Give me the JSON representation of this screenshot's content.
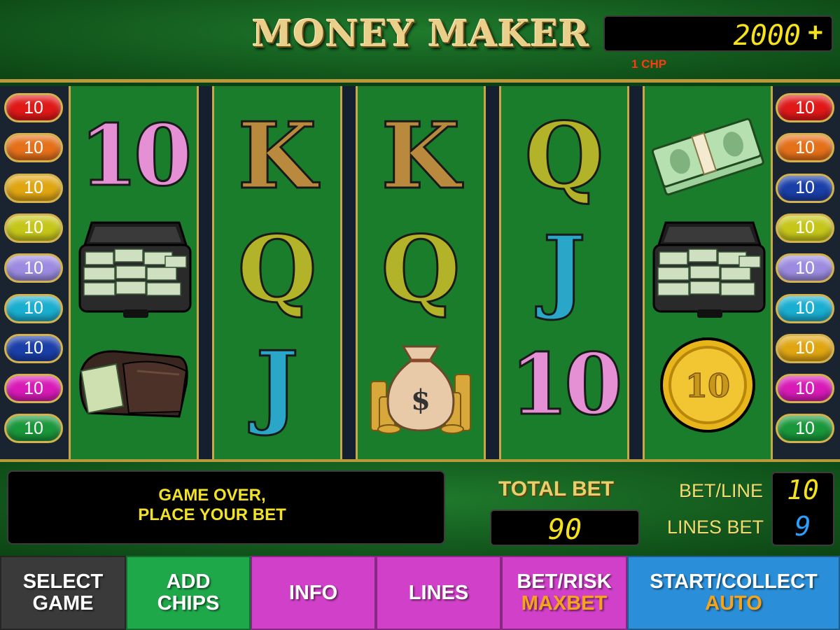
{
  "header": {
    "title": "MONEY MAKER",
    "credit": "2000",
    "credit_suffix": "+",
    "denomination": "1 CHP"
  },
  "paylines": {
    "left": [
      {
        "label": "10",
        "color": "#e01818"
      },
      {
        "label": "10",
        "color": "#e5701a"
      },
      {
        "label": "10",
        "color": "#e0a612"
      },
      {
        "label": "10",
        "color": "#c6c61a"
      },
      {
        "label": "10",
        "color": "#9c8be0"
      },
      {
        "label": "10",
        "color": "#1aaed0"
      },
      {
        "label": "10",
        "color": "#1a3fa8"
      },
      {
        "label": "10",
        "color": "#d81ab6"
      },
      {
        "label": "10",
        "color": "#19973a"
      }
    ],
    "right": [
      {
        "label": "10",
        "color": "#e01818"
      },
      {
        "label": "10",
        "color": "#e5701a"
      },
      {
        "label": "10",
        "color": "#1a3fa8"
      },
      {
        "label": "10",
        "color": "#c6c61a"
      },
      {
        "label": "10",
        "color": "#9c8be0"
      },
      {
        "label": "10",
        "color": "#1aaed0"
      },
      {
        "label": "10",
        "color": "#e0a612"
      },
      {
        "label": "10",
        "color": "#d81ab6"
      },
      {
        "label": "10",
        "color": "#19973a"
      }
    ]
  },
  "reels": [
    {
      "symbols": [
        {
          "type": "letter",
          "text": "10",
          "color": "#e58fd4"
        },
        {
          "type": "icon",
          "icon": "briefcase-of-money-icon"
        },
        {
          "type": "icon",
          "icon": "wallet-icon"
        }
      ]
    },
    {
      "symbols": [
        {
          "type": "letter",
          "text": "K",
          "color": "#b98a3e"
        },
        {
          "type": "letter",
          "text": "Q",
          "color": "#b3b32a"
        },
        {
          "type": "letter",
          "text": "J",
          "color": "#2aa6c8"
        }
      ]
    },
    {
      "symbols": [
        {
          "type": "letter",
          "text": "K",
          "color": "#b98a3e"
        },
        {
          "type": "letter",
          "text": "Q",
          "color": "#b3b32a"
        },
        {
          "type": "icon",
          "icon": "money-bag-icon"
        }
      ]
    },
    {
      "symbols": [
        {
          "type": "letter",
          "text": "Q",
          "color": "#b3b32a"
        },
        {
          "type": "letter",
          "text": "J",
          "color": "#2aa6c8"
        },
        {
          "type": "letter",
          "text": "10",
          "color": "#e58fd4"
        }
      ]
    },
    {
      "symbols": [
        {
          "type": "icon",
          "icon": "cash-bundle-icon"
        },
        {
          "type": "icon",
          "icon": "briefcase-of-money-icon"
        },
        {
          "type": "icon",
          "icon": "gold-coin-icon",
          "text": "10"
        }
      ]
    }
  ],
  "status": {
    "message_line1": "GAME OVER,",
    "message_line2": "PLACE YOUR BET",
    "total_bet_label": "TOTAL BET",
    "total_bet_value": "90",
    "bet_line_label": "BET/LINE",
    "bet_line_value": "10",
    "lines_bet_label": "LINES BET",
    "lines_bet_value": "9"
  },
  "buttons": [
    {
      "line1": "SELECT",
      "line2": "GAME",
      "sub": "",
      "color": "#3a3a3a"
    },
    {
      "line1": "ADD",
      "line2": "CHIPS",
      "sub": "",
      "color": "#1fa84a"
    },
    {
      "line1": "INFO",
      "line2": "",
      "sub": "",
      "color": "#d040c8"
    },
    {
      "line1": "LINES",
      "line2": "",
      "sub": "",
      "color": "#d040c8"
    },
    {
      "line1": "BET/RISK",
      "line2": "",
      "sub": "MAXBET",
      "color": "#d040c8"
    },
    {
      "line1": "START/COLLECT",
      "line2": "",
      "sub": "AUTO",
      "color": "#2a8fd8"
    }
  ]
}
